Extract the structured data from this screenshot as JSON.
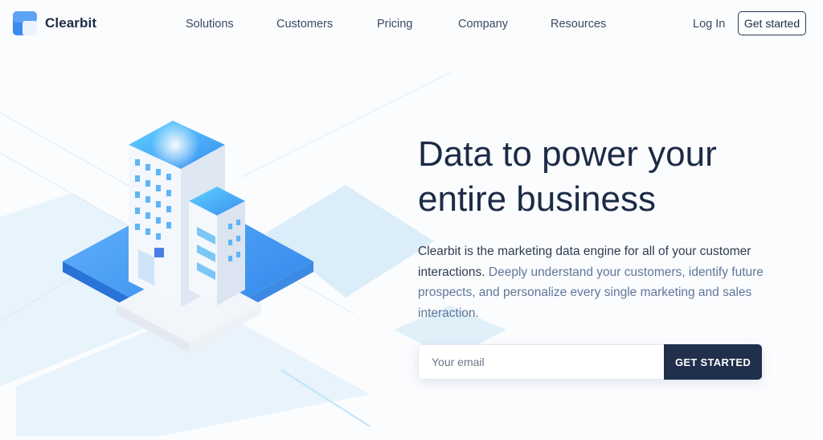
{
  "brand": {
    "name": "Clearbit",
    "accent": "#3a8bf0",
    "dark": "#1f2f4c"
  },
  "nav": {
    "items": [
      "Solutions",
      "Customers",
      "Pricing",
      "Company",
      "Resources"
    ],
    "login": "Log In",
    "get_started": "Get started"
  },
  "hero": {
    "headline_line1": "Data to power your",
    "headline_line2": "entire business",
    "lead_strong": "Clearbit is the marketing data engine for all of your customer interactions.",
    "lead_soft": "Deeply understand your customers, identify future prospects, and personalize every single marketing and sales interaction.",
    "email_placeholder": "Your email",
    "email_value": "",
    "cta": "GET STARTED"
  },
  "illustration": {
    "subject": "isometric-office-buildings",
    "icon": "building-icon"
  }
}
